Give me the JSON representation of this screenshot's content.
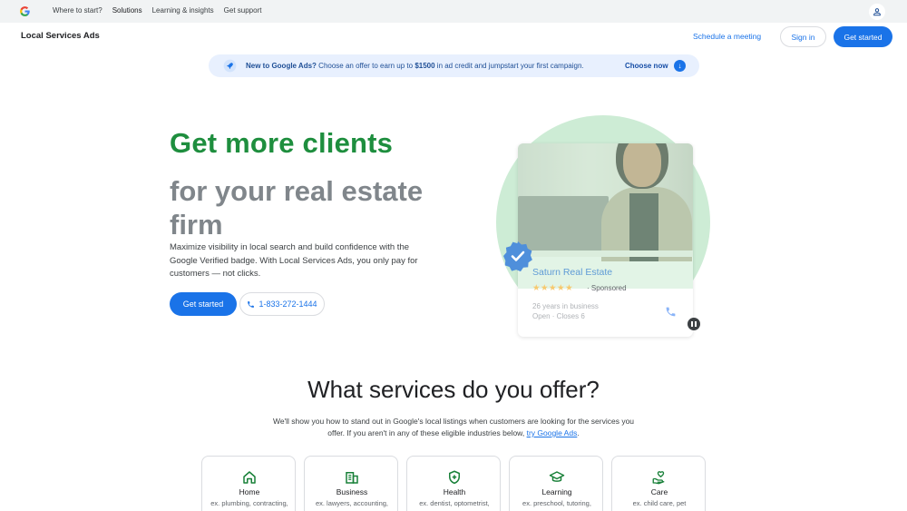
{
  "topnav": {
    "logo_alt": "Google",
    "links": [
      "Where to start?",
      "Solutions",
      "Learning & insights",
      "Get support"
    ]
  },
  "header": {
    "product_name": "Local Services Ads",
    "schedule_label": "Schedule a meeting",
    "signin_label": "Sign in",
    "get_started_label": "Get started"
  },
  "promo": {
    "lead": "New to Google Ads?",
    "text_before": " Choose an offer to earn up to ",
    "amount": "$1500",
    "text_after": " in ad credit and jumpstart your first campaign.",
    "cta": "Choose now"
  },
  "hero": {
    "title": "Get more clients",
    "subtitle": "for your real estate firm",
    "description": "Maximize visibility in local search and build confidence with the Google Verified badge. With Local Services Ads, you only pay for customers — not clicks.",
    "get_started_label": "Get started",
    "phone_label": "1-833-272-1444"
  },
  "card": {
    "business_name": "Saturn Real Estate",
    "rating_stars": "★★★★★",
    "sponsored": "· Sponsored",
    "years": "26 years in business",
    "hours": "Open · Closes 6"
  },
  "services": {
    "title": "What services do you offer?",
    "desc_main": "We'll show you how to stand out in Google's local listings when customers are looking for the services you offer. If you aren't in any of these eligible industries below, ",
    "desc_link": "try Google Ads",
    "desc_end": ".",
    "tiles": [
      {
        "name": "Home",
        "example": "ex. plumbing, contracting,",
        "icon": "home-icon"
      },
      {
        "name": "Business",
        "example": "ex. lawyers, accounting,",
        "icon": "building-icon"
      },
      {
        "name": "Health",
        "example": "ex. dentist, optometrist,",
        "icon": "shield-plus-icon"
      },
      {
        "name": "Learning",
        "example": "ex. preschool, tutoring,",
        "icon": "graduation-cap-icon"
      },
      {
        "name": "Care",
        "example": "ex. child care, pet",
        "icon": "heart-hand-icon"
      }
    ]
  },
  "colors": {
    "brand_blue": "#1a73e8",
    "hero_green": "#1e8e3e",
    "hero_grey": "#80868b",
    "circle_green": "#cdecd5"
  }
}
